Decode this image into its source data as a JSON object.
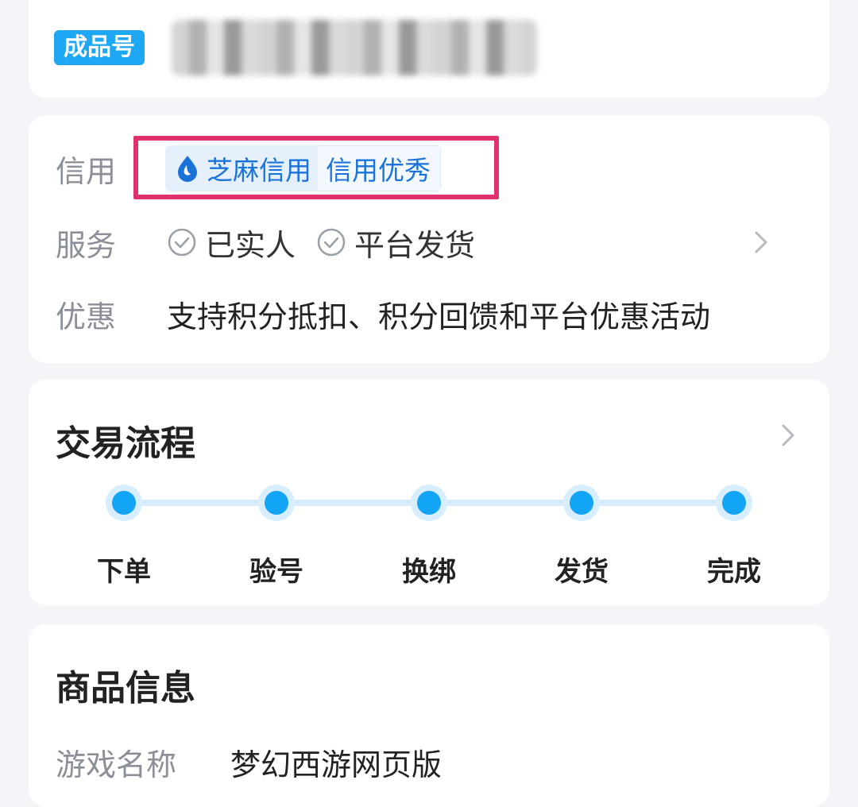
{
  "account": {
    "badge": "成品号"
  },
  "details": {
    "credit_label": "信用",
    "credit_brand": "芝麻信用",
    "credit_level": "信用优秀",
    "service_label": "服务",
    "services": [
      "已实人",
      "平台发货"
    ],
    "promo_label": "优惠",
    "promo_text": "支持积分抵扣、积分回馈和平台优惠活动"
  },
  "trade_flow": {
    "title": "交易流程",
    "steps": [
      "下单",
      "验号",
      "换绑",
      "发货",
      "完成"
    ]
  },
  "product_info": {
    "title": "商品信息",
    "fields": [
      {
        "label": "游戏名称",
        "value": "梦幻西游网页版"
      }
    ]
  },
  "colors": {
    "accent_blue": "#12a5f5",
    "credit_blue": "#1a73d9",
    "highlight_box": "#e0306e",
    "label_gray": "#8b8f97"
  }
}
